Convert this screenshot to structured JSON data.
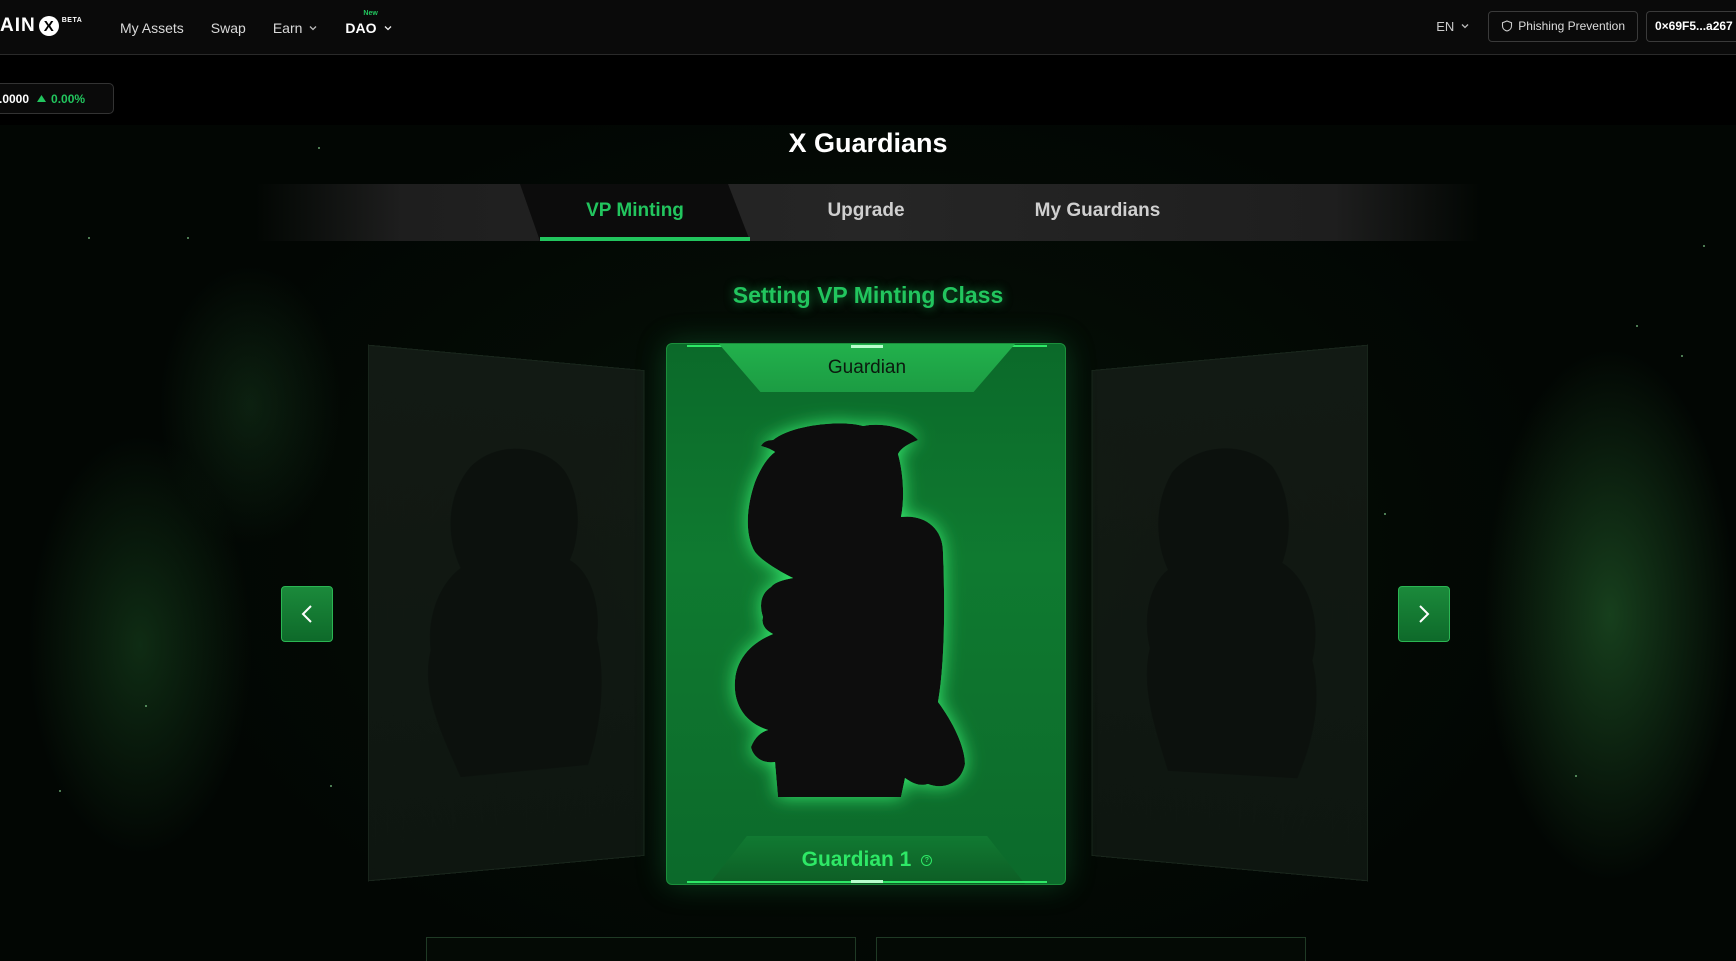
{
  "header": {
    "logo_text": "AIN",
    "logo_mark": "X",
    "logo_badge": "BETA",
    "nav": [
      {
        "label": "My Assets",
        "has_dropdown": false
      },
      {
        "label": "Swap",
        "has_dropdown": false
      },
      {
        "label": "Earn",
        "has_dropdown": true
      },
      {
        "label": "DAO",
        "has_dropdown": true,
        "badge": "New"
      }
    ],
    "language": "EN",
    "phishing_button": "Phishing Prevention",
    "wallet_address": "0×69F5...a267"
  },
  "ticker": {
    "price": ".0000",
    "change": "0.00%",
    "change_color": "#22c55e"
  },
  "page": {
    "title": "X Guardians",
    "tabs": [
      {
        "label": "VP Minting",
        "active": true
      },
      {
        "label": "Upgrade",
        "active": false
      },
      {
        "label": "My Guardians",
        "active": false
      }
    ],
    "section_title": "Setting VP Minting Class"
  },
  "carousel": {
    "current_card": {
      "top_label": "Guardian",
      "bottom_label": "Guardian 1",
      "help_icon": "question-icon"
    },
    "prev_icon": "chevron-left-icon",
    "next_icon": "chevron-right-icon"
  },
  "colors": {
    "accent": "#22c55e",
    "card_green": "#0f7a30",
    "background": "#000000"
  }
}
